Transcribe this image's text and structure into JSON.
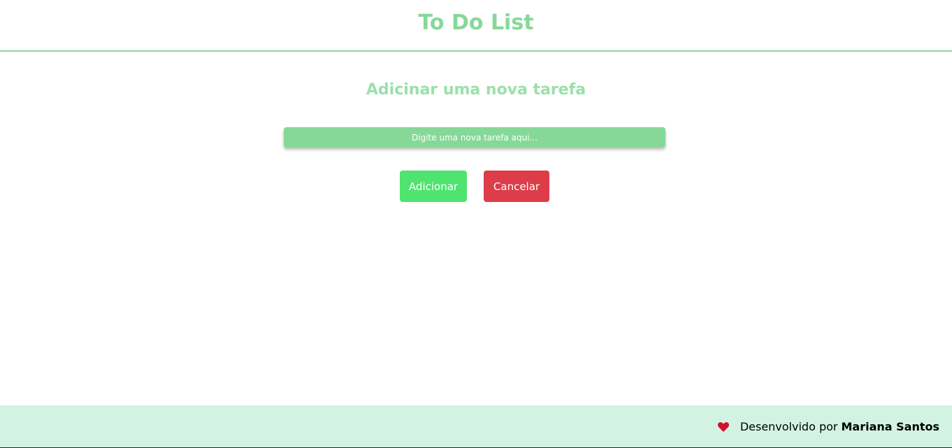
{
  "header": {
    "title": "To Do List"
  },
  "form": {
    "heading": "Adicinar uma nova tarefa",
    "input_placeholder": "Digite uma nova tarefa aqui...",
    "input_value": "",
    "add_label": "Adicionar",
    "cancel_label": "Cancelar"
  },
  "footer": {
    "icon": "heart-icon",
    "text": "Desenvolvido por",
    "author": "Mariana Santos"
  },
  "colors": {
    "accent_green": "#86d898",
    "heading_green": "#9be0ab",
    "add_button": "#4fe36f",
    "cancel_button": "#dc3d48",
    "footer_bg": "#d2f3e3",
    "heart": "#d0112b"
  }
}
